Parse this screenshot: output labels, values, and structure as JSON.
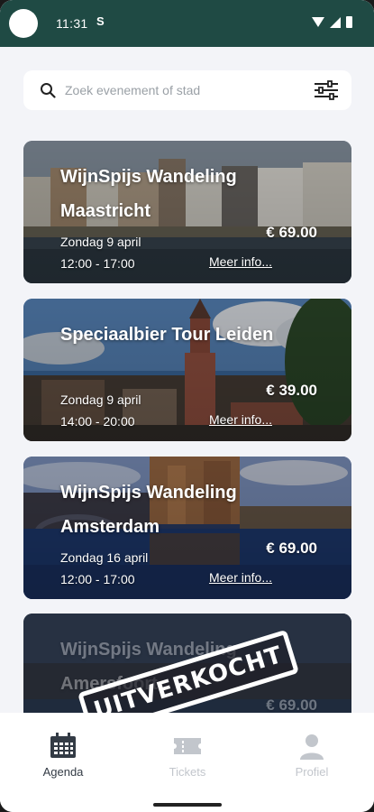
{
  "status": {
    "time": "11:31",
    "sim_label": "S"
  },
  "search": {
    "placeholder": "Zoek evenement of stad"
  },
  "events": [
    {
      "title": "WijnSpijs Wandeling Maastricht",
      "date": "Zondag 9 april",
      "time": "12:00 - 17:00",
      "price": "€ 69.00",
      "more": "Meer info...",
      "sold_out": false
    },
    {
      "title": "Speciaalbier Tour Leiden",
      "date": "Zondag 9 april",
      "time": "14:00 - 20:00",
      "price": "€ 39.00",
      "more": "Meer info...",
      "sold_out": false
    },
    {
      "title": "WijnSpijs Wandeling Amsterdam",
      "date": "Zondag 16 april",
      "time": "12:00 - 17:00",
      "price": "€ 69.00",
      "more": "Meer info...",
      "sold_out": false
    },
    {
      "title": "WijnSpijs Wandeling Amersfoort",
      "date": "",
      "time": "",
      "price": "€ 69.00",
      "more": "",
      "sold_out": true,
      "stamp": "UITVERKOCHT"
    }
  ],
  "nav": {
    "items": [
      {
        "label": "Agenda",
        "icon": "calendar-icon",
        "active": true
      },
      {
        "label": "Tickets",
        "icon": "ticket-icon",
        "active": false
      },
      {
        "label": "Profiel",
        "icon": "person-icon",
        "active": false
      }
    ]
  },
  "colors": {
    "header": "#1f4a44",
    "background": "#f3f4f8",
    "nav_active": "#333b45",
    "nav_inactive": "#c2c6cc"
  }
}
